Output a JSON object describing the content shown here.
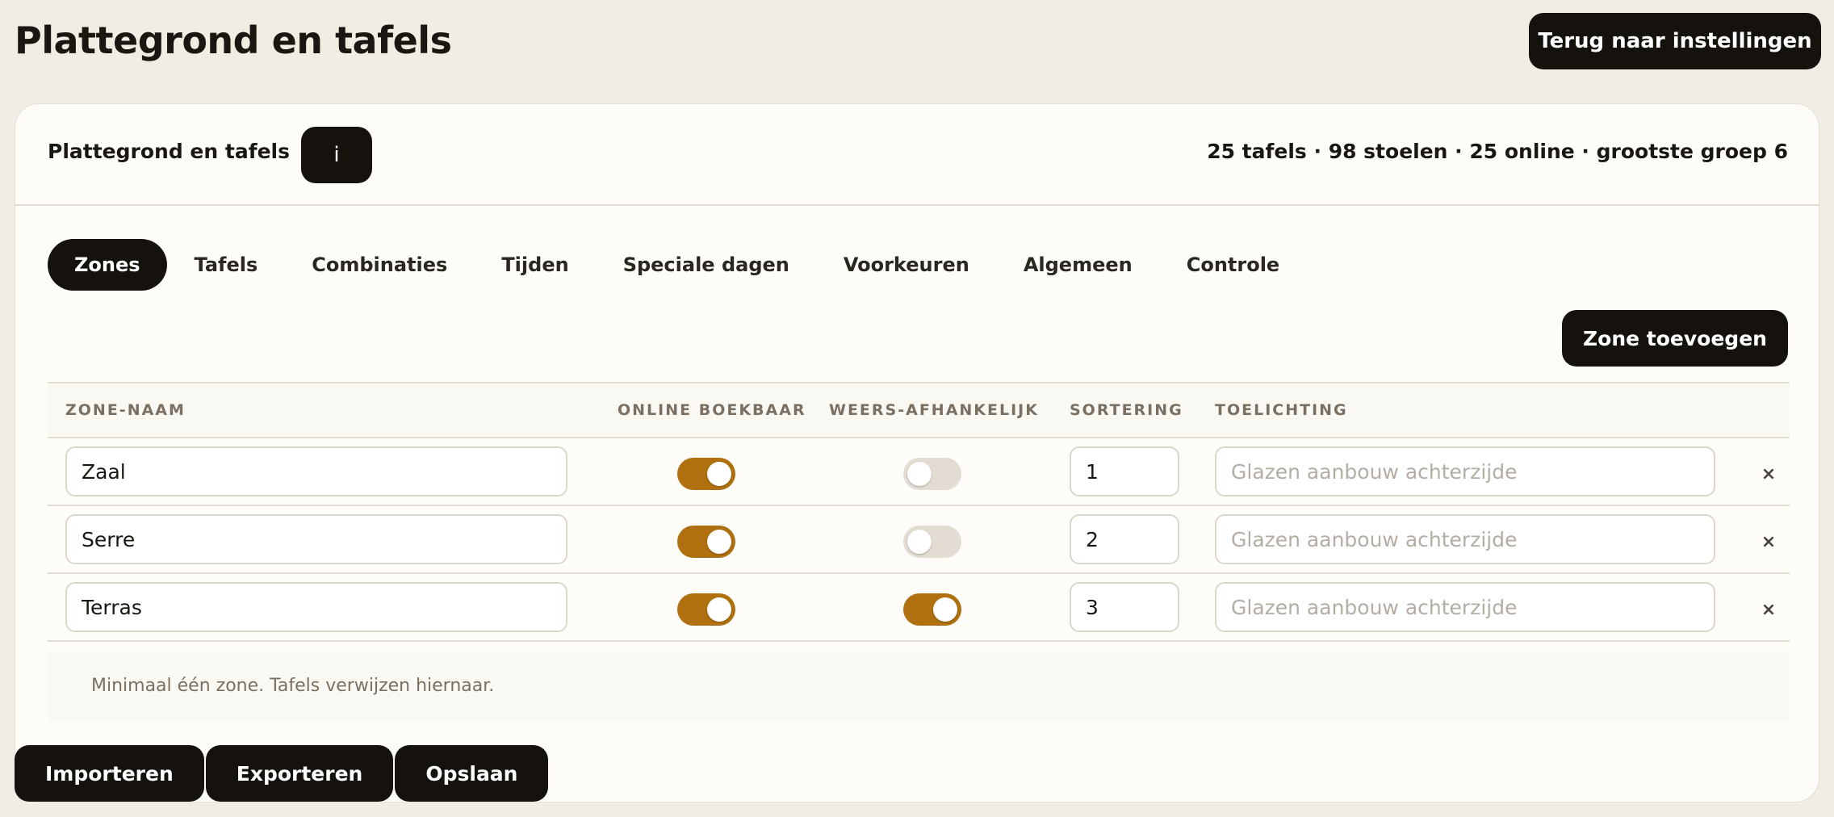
{
  "page": {
    "title": "Plattegrond en tafels",
    "back_label": "Terug naar instellingen"
  },
  "card": {
    "title": "Plattegrond en tafels",
    "info_label": "i",
    "summary": "25 tafels · 98 stoelen · 25 online · grootste groep 6"
  },
  "tabs": [
    {
      "label": "Zones",
      "active": true
    },
    {
      "label": "Tafels"
    },
    {
      "label": "Combinaties"
    },
    {
      "label": "Tijden"
    },
    {
      "label": "Speciale dagen"
    },
    {
      "label": "Voorkeuren"
    },
    {
      "label": "Algemeen"
    },
    {
      "label": "Controle"
    }
  ],
  "add_zone_label": "Zone toevoegen",
  "table": {
    "headers": {
      "name": "ZONE-NAAM",
      "online": "ONLINE BOEKBAAR",
      "weather": "WEERS-AFHANKELIJK",
      "sort": "SORTERING",
      "note": "TOELICHTING"
    },
    "rows": [
      {
        "name": "Zaal",
        "online": true,
        "weather": false,
        "sort": "1",
        "note_placeholder": "Glazen aanbouw achterzijde",
        "delete": "×"
      },
      {
        "name": "Serre",
        "online": true,
        "weather": false,
        "sort": "2",
        "note_placeholder": "Glazen aanbouw achterzijde",
        "delete": "×"
      },
      {
        "name": "Terras",
        "online": true,
        "weather": true,
        "sort": "3",
        "note_placeholder": "Glazen aanbouw achterzijde",
        "delete": "×"
      }
    ],
    "footer_note": "Minimaal één zone. Tafels verwijzen hiernaar."
  },
  "actions": {
    "import": "Importeren",
    "export": "Exporteren",
    "save": "Opslaan"
  },
  "colors": {
    "accent": "#b0700f",
    "dark": "#15120d",
    "background": "#f1ede4"
  }
}
